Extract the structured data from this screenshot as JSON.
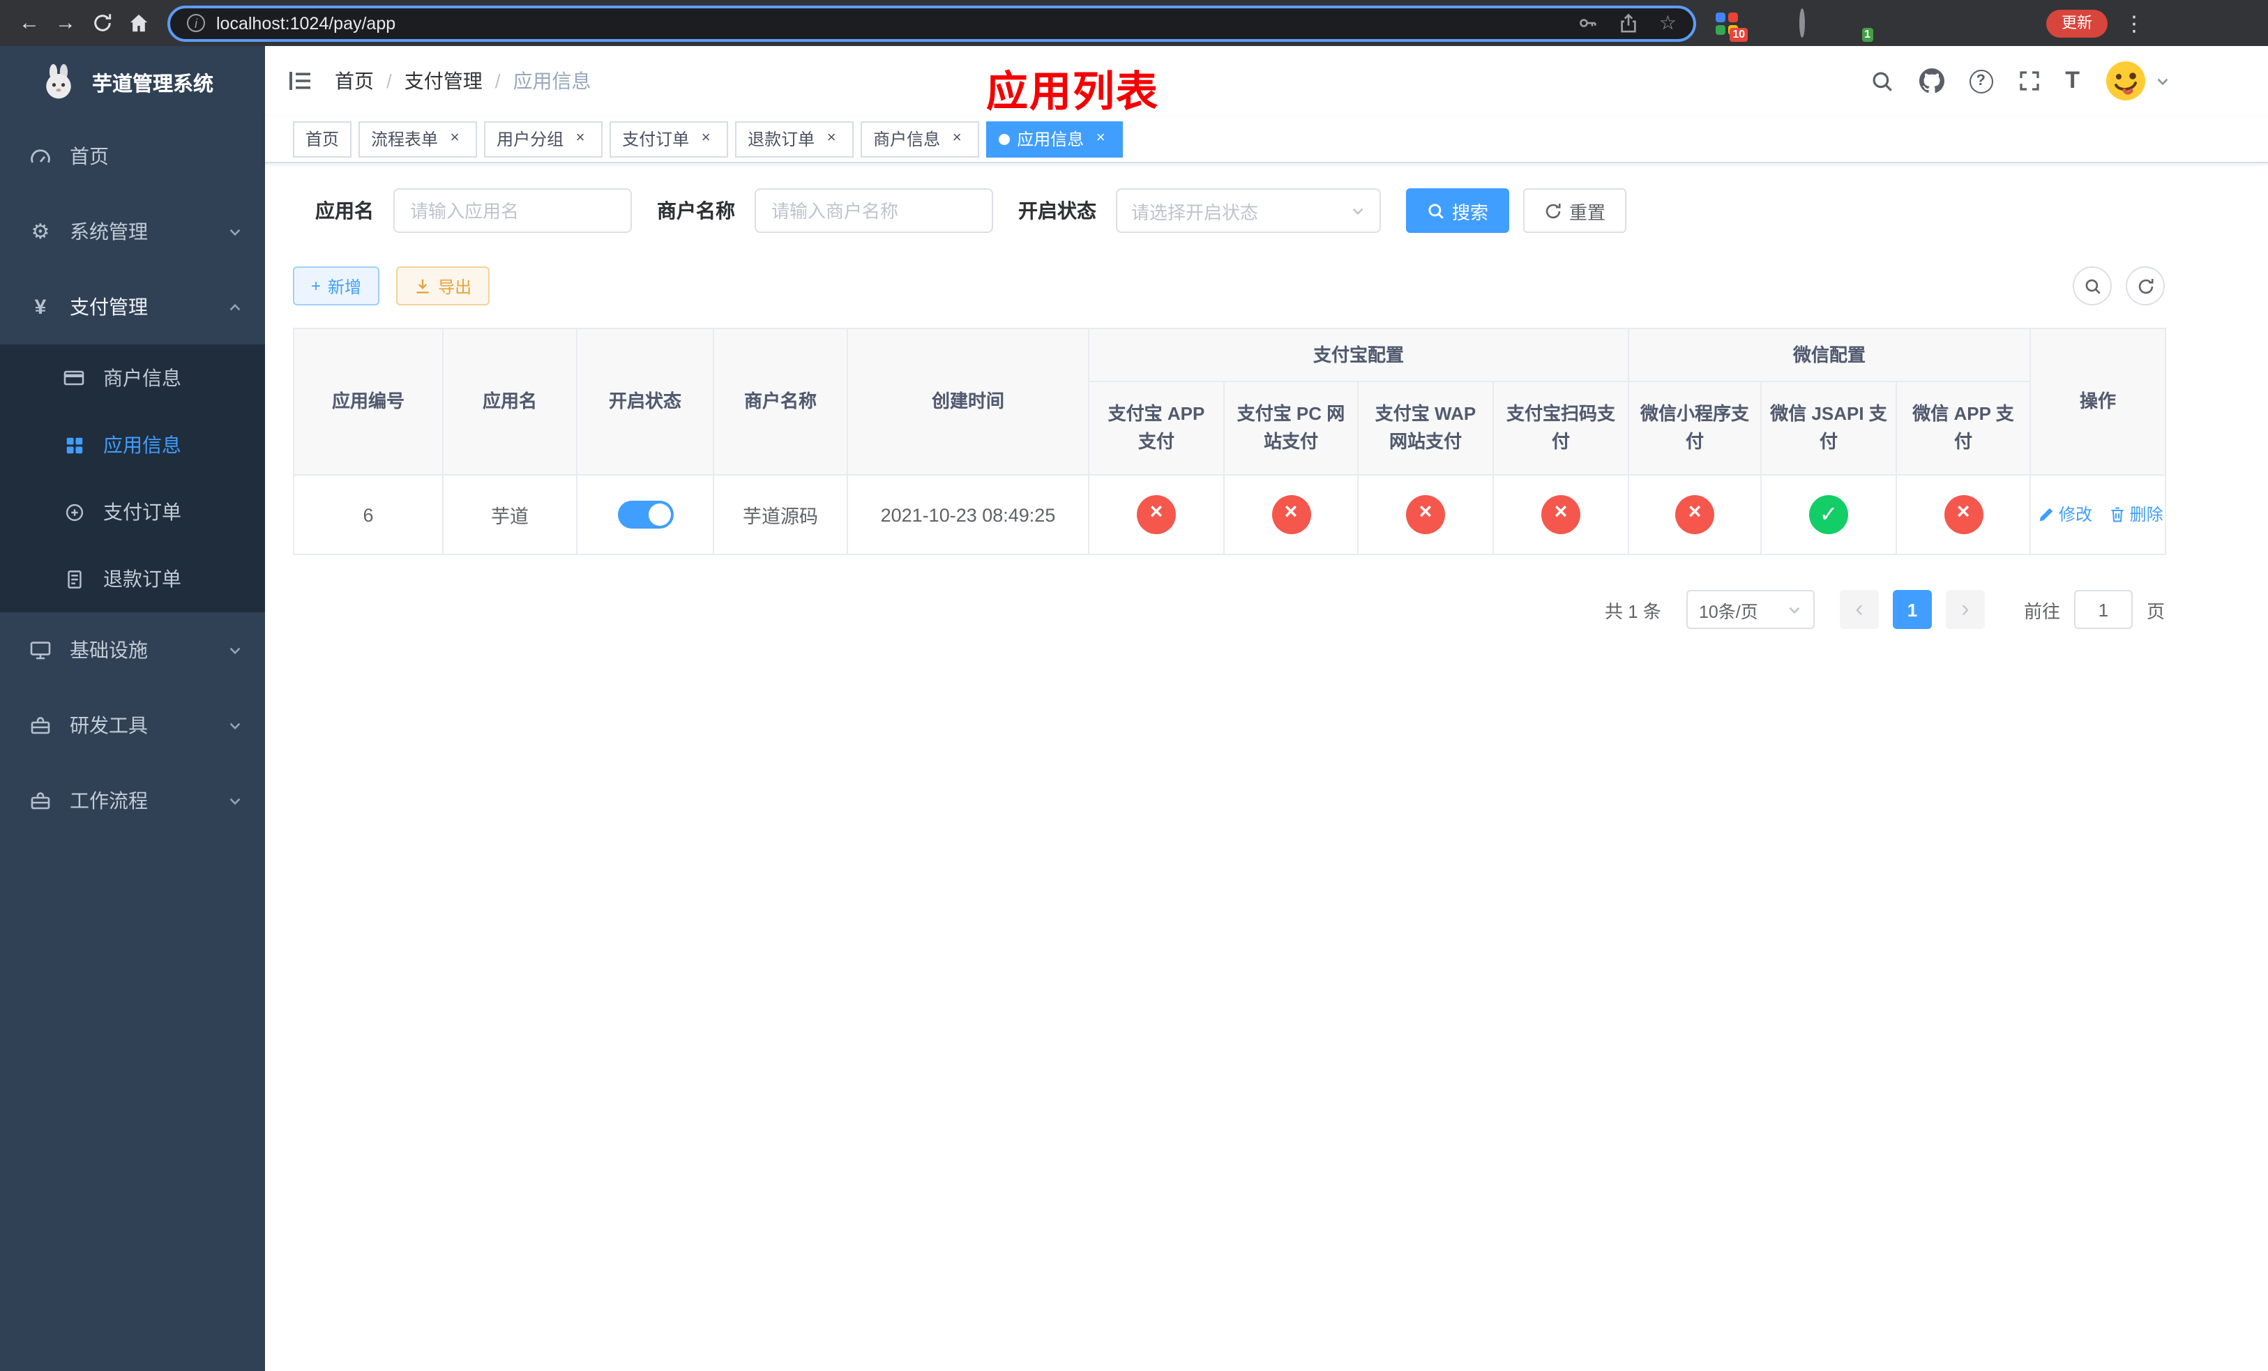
{
  "browser": {
    "url": "localhost:1024/pay/app",
    "update_button": "更新",
    "ext_badge_1": "10",
    "ext_badge_2": "1"
  },
  "icons": {
    "back": "←",
    "forward": "→",
    "star": "☆",
    "menu_kebab": "⋮",
    "info": "i",
    "gear": "⚙",
    "yen": "¥",
    "plus": "+",
    "help": "?",
    "font_size": "T",
    "prev": "‹",
    "next": "›",
    "close": "×"
  },
  "sidebar": {
    "app_title": "芋道管理系统",
    "items": [
      {
        "label": "首页"
      },
      {
        "label": "系统管理"
      },
      {
        "label": "支付管理"
      },
      {
        "label": "基础设施"
      },
      {
        "label": "研发工具"
      },
      {
        "label": "工作流程"
      }
    ],
    "payment_submenu": [
      {
        "label": "商户信息"
      },
      {
        "label": "应用信息"
      },
      {
        "label": "支付订单"
      },
      {
        "label": "退款订单"
      }
    ]
  },
  "navbar": {
    "breadcrumb": [
      {
        "label": "首页"
      },
      {
        "label": "支付管理"
      },
      {
        "label": "应用信息"
      }
    ],
    "page_title": "应用列表"
  },
  "tabs": [
    {
      "label": "首页"
    },
    {
      "label": "流程表单"
    },
    {
      "label": "用户分组"
    },
    {
      "label": "支付订单"
    },
    {
      "label": "退款订单"
    },
    {
      "label": "商户信息"
    },
    {
      "label": "应用信息"
    }
  ],
  "filters": {
    "app_name_label": "应用名",
    "app_name_placeholder": "请输入应用名",
    "merchant_label": "商户名称",
    "merchant_placeholder": "请输入商户名称",
    "status_label": "开启状态",
    "status_placeholder": "请选择开启状态",
    "search_button": "搜索",
    "reset_button": "重置"
  },
  "toolbar": {
    "add_button": "新增",
    "export_button": "导出"
  },
  "table": {
    "headers": {
      "app_id": "应用编号",
      "app_name": "应用名",
      "status": "开启状态",
      "merchant_name": "商户名称",
      "create_time": "创建时间",
      "alipay_group": "支付宝配置",
      "alipay_app": "支付宝 APP 支付",
      "alipay_pc": "支付宝 PC 网站支付",
      "alipay_wap": "支付宝 WAP 网站支付",
      "alipay_qr": "支付宝扫码支付",
      "wechat_group": "微信配置",
      "wechat_mini": "微信小程序支付",
      "wechat_jsapi": "微信 JSAPI 支付",
      "wechat_app": "微信 APP 支付",
      "actions": "操作"
    },
    "rows": [
      {
        "app_id": "6",
        "app_name": "芋道",
        "merchant_name": "芋道源码",
        "create_time": "2021-10-23 08:49:25",
        "configs": [
          "fail",
          "fail",
          "fail",
          "fail",
          "fail",
          "success",
          "fail"
        ],
        "edit": "修改",
        "delete": "删除"
      }
    ]
  },
  "pagination": {
    "total": "共 1 条",
    "page_size": "10条/页",
    "current_page": "1",
    "goto_prefix": "前往",
    "goto_value": "1",
    "goto_suffix": "页"
  }
}
